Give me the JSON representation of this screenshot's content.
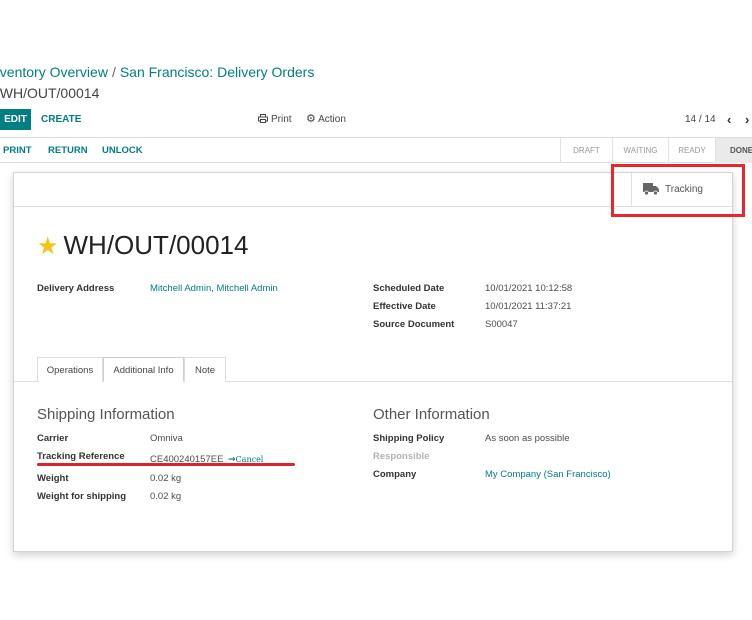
{
  "breadcrumb": {
    "items": [
      "nventory Overview",
      "San Francisco: Delivery Orders"
    ],
    "separator": "/",
    "current": "/ WH/OUT/00014"
  },
  "control_panel": {
    "edit_label": "EDIT",
    "create_label": "CREATE",
    "print_label": "Print",
    "action_label": "Action",
    "pager": "14 / 14",
    "prev_icon": "chevron-left-icon",
    "next_icon": "chevron-right-icon"
  },
  "statusbar": {
    "buttons": [
      "PRINT",
      "RETURN",
      "UNLOCK"
    ],
    "stages": [
      "DRAFT",
      "WAITING",
      "READY",
      "DONE"
    ],
    "current_stage": "DONE"
  },
  "smart_buttons": {
    "tracking_label": "Tracking",
    "tracking_icon": "truck-icon"
  },
  "record": {
    "title": "WH/OUT/00014",
    "favorite": true
  },
  "fields": {
    "delivery_address_label": "Delivery Address",
    "delivery_address_value": "Mitchell Admin, Mitchell Admin",
    "scheduled_date_label": "Scheduled Date",
    "scheduled_date_value": "10/01/2021 10:12:58",
    "effective_date_label": "Effective Date",
    "effective_date_value": "10/01/2021 11:37:21",
    "source_document_label": "Source Document",
    "source_document_value": "S00047"
  },
  "tabs": [
    "Operations",
    "Additional Info",
    "Note"
  ],
  "active_tab": "Additional Info",
  "shipping": {
    "title": "Shipping Information",
    "carrier_label": "Carrier",
    "carrier_value": "Omniva",
    "tracking_ref_label": "Tracking Reference",
    "tracking_ref_value": "CE400240157EE",
    "cancel_label": "Cancel",
    "weight_label": "Weight",
    "weight_value": "0.02 kg",
    "weight_shipping_label": "Weight for shipping",
    "weight_shipping_value": "0.02 kg"
  },
  "other": {
    "title": "Other Information",
    "policy_label": "Shipping Policy",
    "policy_value": "As soon as possible",
    "responsible_label": "Responsible",
    "company_label": "Company",
    "company_value": "My Company (San Francisco)"
  },
  "colors": {
    "accent": "#017e84",
    "annotation": "#e8262c",
    "star": "#f3c315"
  }
}
